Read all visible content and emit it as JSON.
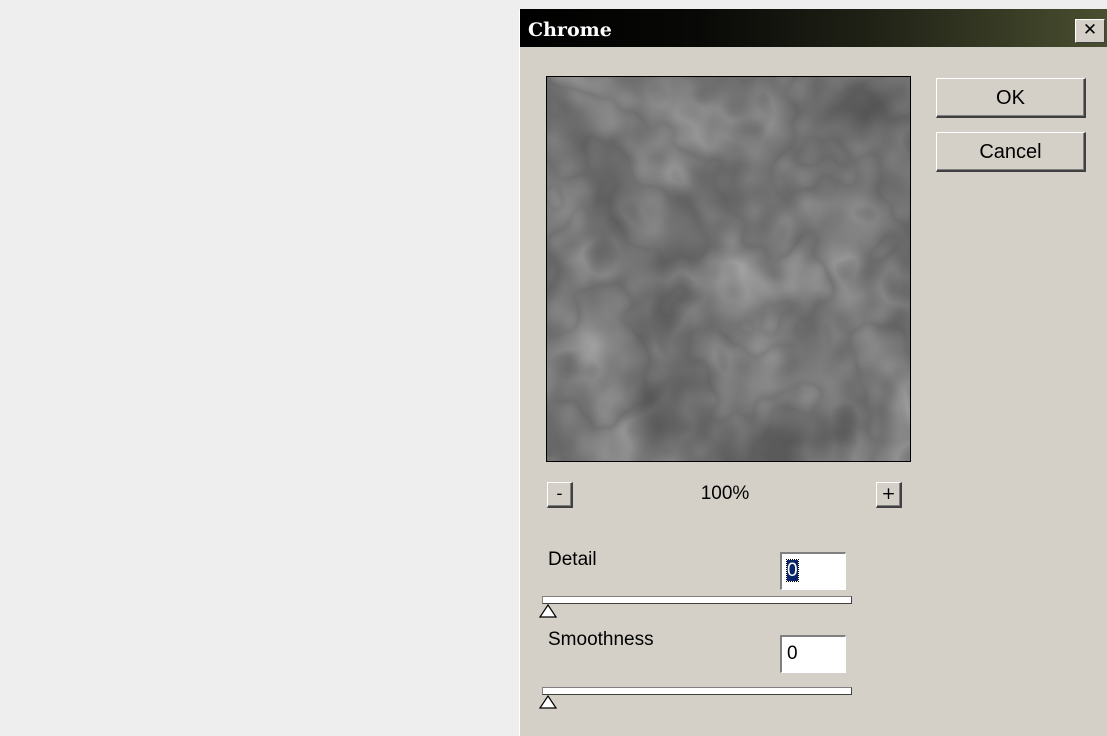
{
  "dialog": {
    "title": "Chrome",
    "close_label": "✕",
    "ok_label": "OK",
    "cancel_label": "Cancel"
  },
  "preview": {
    "zoom_out_label": "-",
    "zoom_in_label": "+",
    "zoom_level": "100%"
  },
  "settings": {
    "detail": {
      "label": "Detail",
      "value": "0",
      "slider_fraction": 0
    },
    "smoothness": {
      "label": "Smoothness",
      "value": "0",
      "slider_fraction": 0
    }
  },
  "colors": {
    "dialog_bg": "#d4d0c8",
    "desktop_bg": "#eeeeee",
    "selection": "#0a246a"
  }
}
